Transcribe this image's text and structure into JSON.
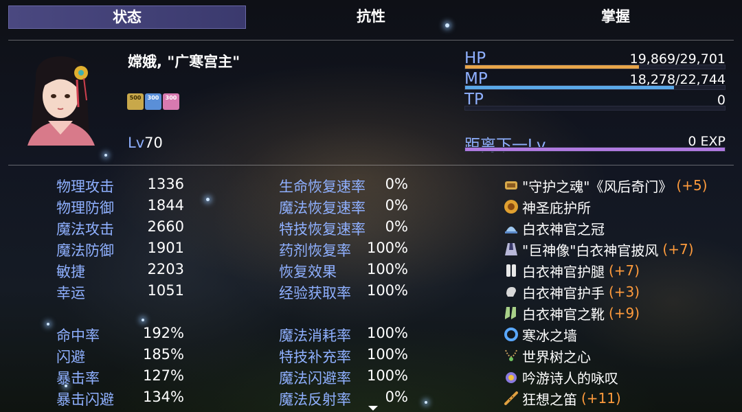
{
  "tabs": [
    {
      "label": "状态",
      "active": true
    },
    {
      "label": "抗性",
      "active": false
    },
    {
      "label": "掌握",
      "active": false
    }
  ],
  "character": {
    "name": "嫦娥, \"广寒宫主\"",
    "level_label": "Lv",
    "level": "70",
    "badges": [
      {
        "text": "500",
        "color": "#c8a84a",
        "icon": "coin-icon"
      },
      {
        "text": "300",
        "color": "#5a8fd8",
        "icon": "crystal-icon"
      },
      {
        "text": "300",
        "color": "#d87ab0",
        "icon": "scroll-icon"
      }
    ]
  },
  "gauges": {
    "hp": {
      "label": "HP",
      "value": "19,869/29,701",
      "ratio": 0.669,
      "color": "#e8a54a"
    },
    "mp": {
      "label": "MP",
      "value": "18,278/22,744",
      "ratio": 0.804,
      "color": "#5aa8e8"
    },
    "tp": {
      "label": "TP",
      "value": "0",
      "ratio": 0,
      "color": "#5a9a5a"
    },
    "exp": {
      "label": "距离下一Lv",
      "value": "0 EXP",
      "ratio": 1,
      "color": "#b07ae0"
    }
  },
  "stats_left": [
    {
      "label": "物理攻击",
      "value": "1336"
    },
    {
      "label": "物理防御",
      "value": "1844"
    },
    {
      "label": "魔法攻击",
      "value": "2660"
    },
    {
      "label": "魔法防御",
      "value": "1901"
    },
    {
      "label": "敏捷",
      "value": "2203"
    },
    {
      "label": "幸运",
      "value": "1051"
    }
  ],
  "stats_left2": [
    {
      "label": "命中率",
      "value": "192%"
    },
    {
      "label": "闪避",
      "value": "185%"
    },
    {
      "label": "暴击率",
      "value": "127%"
    },
    {
      "label": "暴击闪避",
      "value": "134%"
    }
  ],
  "stats_mid": [
    {
      "label": "生命恢复速率",
      "value": "0%"
    },
    {
      "label": "魔法恢复速率",
      "value": "0%"
    },
    {
      "label": "特技恢复速率",
      "value": "0%"
    },
    {
      "label": "药剂恢复率",
      "value": "100%"
    },
    {
      "label": "恢复效果",
      "value": "100%"
    },
    {
      "label": "经验获取率",
      "value": "100%"
    }
  ],
  "stats_mid2": [
    {
      "label": "魔法消耗率",
      "value": "100%"
    },
    {
      "label": "特技补充率",
      "value": "100%"
    },
    {
      "label": "魔法闪避率",
      "value": "100%"
    },
    {
      "label": "魔法反射率",
      "value": "0%"
    }
  ],
  "equipment": [
    {
      "name": "\"守护之魂\"《风后奇门》",
      "plus": "(+5)",
      "icon": "scroll-icon",
      "color": "#d8a94a"
    },
    {
      "name": "神圣庇护所",
      "plus": "",
      "icon": "sun-emblem-icon",
      "color": "#e0a030"
    },
    {
      "name": "白衣神官之冠",
      "plus": "",
      "icon": "hat-icon",
      "color": "#9fc8f0"
    },
    {
      "name": "\"巨神像\"白衣神官披风",
      "plus": "(+7)",
      "icon": "cloak-icon",
      "color": "#b8b8d8"
    },
    {
      "name": "白衣神官护腿",
      "plus": "(+7)",
      "icon": "greaves-icon",
      "color": "#e8e8e8"
    },
    {
      "name": "白衣神官护手",
      "plus": "(+3)",
      "icon": "gauntlet-icon",
      "color": "#d8d8d8"
    },
    {
      "name": "白衣神官之靴",
      "plus": "(+9)",
      "icon": "boots-icon",
      "color": "#a8d088"
    },
    {
      "name": "寒冰之墙",
      "plus": "",
      "icon": "ring-icon",
      "color": "#5aa8ff"
    },
    {
      "name": "世界树之心",
      "plus": "",
      "icon": "necklace-icon",
      "color": "#c8a060"
    },
    {
      "name": "吟游诗人的咏叹",
      "plus": "",
      "icon": "amulet-icon",
      "color": "#8a7ae0"
    },
    {
      "name": "狂想之笛",
      "plus": "(+11)",
      "icon": "flute-icon",
      "color": "#e0a040"
    }
  ]
}
